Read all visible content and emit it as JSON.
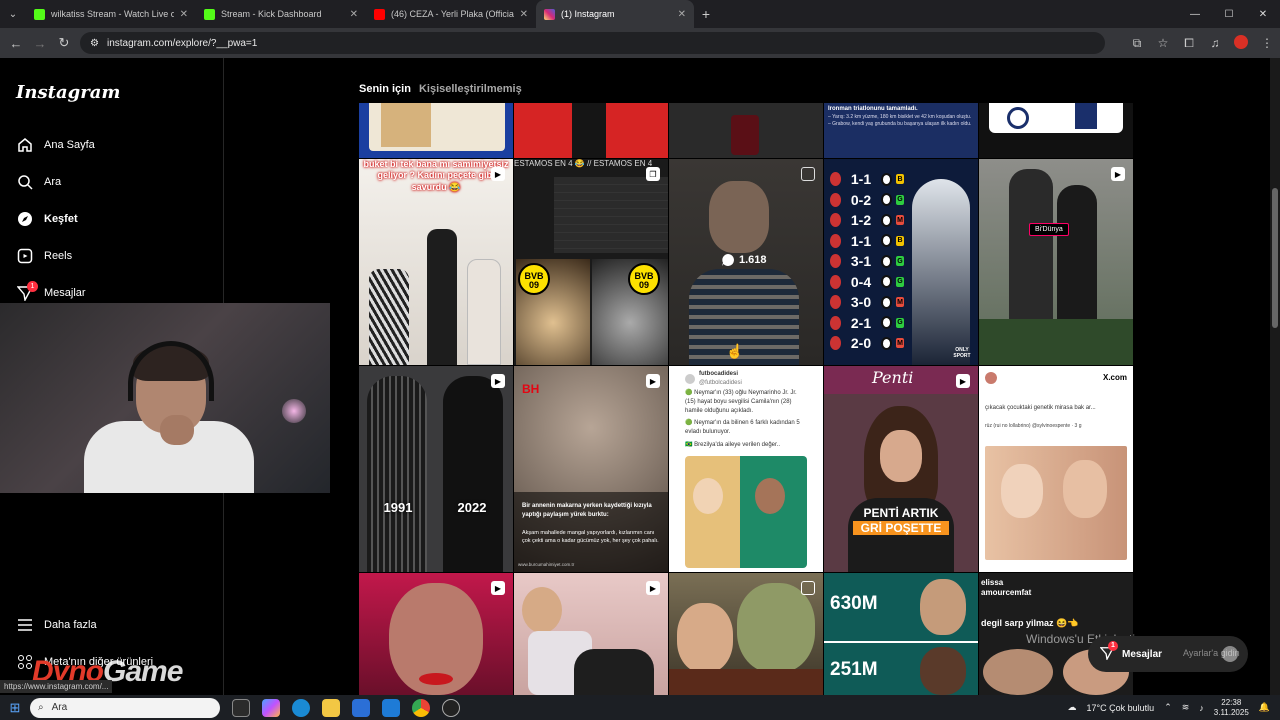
{
  "browser": {
    "tabs": [
      {
        "title": "wilkatiss Stream - Watch Live o",
        "favicon_color": "#53fc18",
        "active": false
      },
      {
        "title": "Stream - Kick Dashboard",
        "favicon_color": "#53fc18",
        "active": false
      },
      {
        "title": "(46) CEZA - Yerli Plaka (Official",
        "favicon_color": "#ff0000",
        "active": false
      },
      {
        "title": "(1) Instagram",
        "favicon_color": "#d62976",
        "active": true
      }
    ],
    "url": "instagram.com/explore/?__pwa=1"
  },
  "sidebar": {
    "logo": "Instagram",
    "items": [
      {
        "label": "Ana Sayfa",
        "icon": "home-icon"
      },
      {
        "label": "Ara",
        "icon": "search-icon"
      },
      {
        "label": "Keşfet",
        "icon": "explore-icon",
        "active": true
      },
      {
        "label": "Reels",
        "icon": "reels-icon"
      },
      {
        "label": "Mesajlar",
        "icon": "messages-icon",
        "badge": "1"
      }
    ],
    "more": "Daha fazla",
    "meta": "Meta'nın diğer ürünleri"
  },
  "feed": {
    "tab_for_you": "Senin için",
    "tab_personalized": "Kişiselleştirilmemiş"
  },
  "posts": {
    "top_triathlon": "Ironman triatlonunu tamamladı.",
    "top_triathlon_2": "– Yarış: 3.2 km yüzme, 180 km bisiklet ve 42 km koşudan oluştu.",
    "top_triathlon_3": "– Grabow, kendi yaş grubunda bu başarıya ulaşan ilk kadın oldu.",
    "dance_caption": "buket bi tek bana mı samimiyetsiz geliyor ? Kadını peçete gibi savurdu 😂",
    "estamos": "ESTAMOS EN 4 😂 // ESTAMOS EN 4",
    "bvb": "BVB",
    "bvb_year": "09",
    "comments": "1.618",
    "scores": [
      {
        "score": "1-1",
        "res": "B",
        "res_color": "#f2c200"
      },
      {
        "score": "0-2",
        "res": "G",
        "res_color": "#2ecc40"
      },
      {
        "score": "1-2",
        "res": "M",
        "res_color": "#e74c3c"
      },
      {
        "score": "1-1",
        "res": "B",
        "res_color": "#f2c200"
      },
      {
        "score": "3-1",
        "res": "G",
        "res_color": "#2ecc40"
      },
      {
        "score": "0-4",
        "res": "G",
        "res_color": "#2ecc40"
      },
      {
        "score": "3-0",
        "res": "M",
        "res_color": "#e74c3c"
      },
      {
        "score": "2-1",
        "res": "G",
        "res_color": "#2ecc40"
      },
      {
        "score": "2-0",
        "res": "M",
        "res_color": "#e74c3c"
      }
    ],
    "only_sport": "ONLY SPORT",
    "bidunya": "Bi'Dünya",
    "year_1991": "1991",
    "year_2022": "2022",
    "bh": "BH",
    "makarna_caption": "Bir annenin makarna yerken kaydettiği kızıyla yaptığı paylaşım yürek burktu:",
    "makarna_caption_2": "Akşam mahallede mangal yapıyorlardı, kızlarımın canı çok çekti ama o kadar gücümüz yok, her şey çok pahalı.",
    "makarna_site": "www.burcumahimiyet.com.tr",
    "futbol_account": "futbocadidesi",
    "futbol_handle": "@futbolcadidesi",
    "futbol_text_1": "🟢 Neymar'ın (33) oğlu Neymarinho Jr. Jr. (15) hayat boyu sevgilisi Camila'nın (28) hamile olduğunu açıkladı.",
    "futbol_text_2": "🟢 Neymar'ın da bilinen 6 farklı kadından 5 evladı bulunuyor.",
    "futbol_text_3": "🇧🇷 Brezilya'da aileye verilen değer..",
    "penti_logo": "Penti",
    "penti_line1": "PENTİ ARTIK",
    "penti_line2": "GRİ POŞETTE",
    "x_brand": "X.com",
    "x_text": "çıkacak çocuktaki genetik mirasa bak ar...",
    "x_reply": "rüz (rui no lollabrino) @sylvinoespente · 3 g",
    "mr_630": "630M",
    "mr_251": "251M",
    "elissa_1": "elissa",
    "elissa_2": "amourcemfat",
    "degil": "degil sarp yilmaz 😆👈"
  },
  "overlay": {
    "activate_title": "Windows'u Etkinleştir",
    "activate_sub": "Ayarlar'a gidin",
    "messages_label": "Mesajlar",
    "messages_badge": "1",
    "status_url": "https://www.instagram.com/...",
    "watermark_a": "Dyno",
    "watermark_b": "Game"
  },
  "taskbar": {
    "search": "Ara",
    "weather": "17°C  Çok bulutlu",
    "time": "22:38",
    "date": "3.11.2025"
  }
}
